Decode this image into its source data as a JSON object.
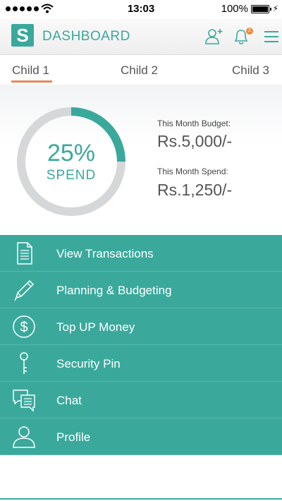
{
  "status_bar": {
    "time": "13:03",
    "battery_percent": "100%",
    "signal_icon": "signal-dots-icon",
    "wifi_icon": "wifi-icon",
    "battery_icon": "battery-icon"
  },
  "header": {
    "logo_letter": "S",
    "title": "DASHBOARD",
    "notification_count": "2",
    "icons": [
      "add-user-icon",
      "bell-icon",
      "hamburger-menu-icon"
    ],
    "accent_color": "#3aa99c",
    "badge_color": "#f08a3c"
  },
  "tabs": [
    {
      "label": "Child 1",
      "active": true
    },
    {
      "label": "Child 2",
      "active": false
    },
    {
      "label": "Child 3",
      "active": false
    }
  ],
  "summary": {
    "spend_percent": "25%",
    "spend_fraction": 0.25,
    "spend_label": "SPEND",
    "budget_label": "This Month Budget:",
    "budget_value": "Rs.5,000/-",
    "spend_caption": "This Month Spend:",
    "spend_value": "Rs.1,250/-",
    "ring_colors": {
      "filled": "#3aa99c",
      "track": "#d6d7d8"
    }
  },
  "menu": {
    "items": [
      {
        "label": "View Transactions",
        "icon": "document-icon"
      },
      {
        "label": "Planning & Budgeting",
        "icon": "pencil-icon"
      },
      {
        "label": "Top UP Money",
        "icon": "dollar-icon"
      },
      {
        "label": "Security Pin",
        "icon": "key-icon"
      },
      {
        "label": "Chat",
        "icon": "chat-icon"
      },
      {
        "label": "Profile",
        "icon": "profile-icon"
      }
    ],
    "background_color": "#3aa99c"
  }
}
